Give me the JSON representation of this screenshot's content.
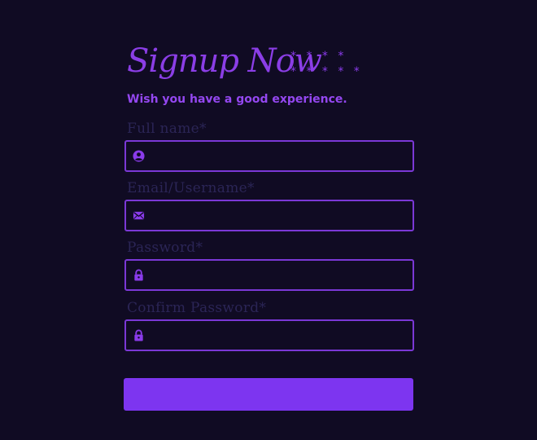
{
  "header": {
    "title": "Signup Now",
    "stars_row1": "* * * *",
    "stars_row2": "* * * * *",
    "subtitle": "Wish you have a good experience."
  },
  "form": {
    "fields": [
      {
        "label": "Full name*",
        "value": "",
        "icon": "user-circle-icon"
      },
      {
        "label": "Email/Username*",
        "value": "",
        "icon": "envelope-icon"
      },
      {
        "label": "Password*",
        "value": "",
        "icon": "lock-icon"
      },
      {
        "label": "Confirm Password*",
        "value": "",
        "icon": "lock-icon"
      }
    ],
    "submit_label": ""
  },
  "colors": {
    "background": "#100b23",
    "accent": "#7d35f0",
    "field_border": "#7b38d6",
    "label": "#2b2556"
  }
}
